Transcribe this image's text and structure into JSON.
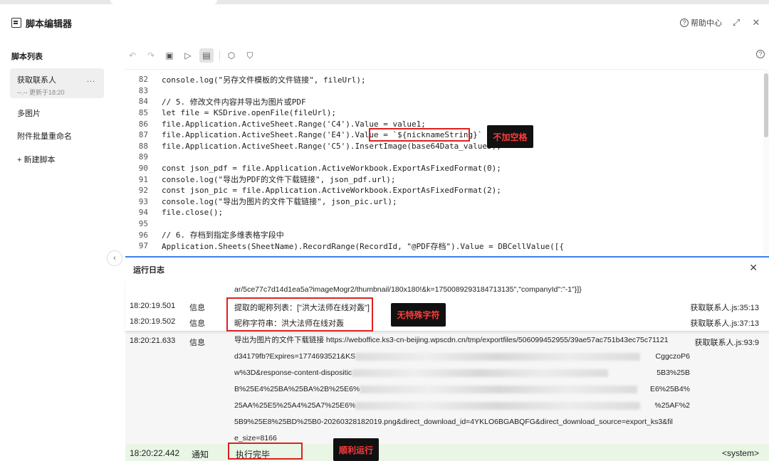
{
  "header": {
    "title": "脚本编辑器",
    "help_label": "帮助中心"
  },
  "sidebar": {
    "section_title": "脚本列表",
    "items": [
      {
        "label": "获取联系人",
        "sub": "--.-- 更新于18:20",
        "more": "..."
      },
      {
        "label": "多图片"
      },
      {
        "label": "附件批量重命名"
      },
      {
        "label": "+ 新建脚本"
      }
    ]
  },
  "code_lines": [
    {
      "ln": "82",
      "code": "console.log(\"另存文件模板的文件链接\", fileUrl);"
    },
    {
      "ln": "83",
      "code": ""
    },
    {
      "ln": "84",
      "code": "// 5. 修改文件内容并导出为图片或PDF"
    },
    {
      "ln": "85",
      "code": "let file = KSDrive.openFile(fileUrl);"
    },
    {
      "ln": "86",
      "code": "file.Application.ActiveSheet.Range('C4').Value = value1;"
    },
    {
      "ln": "87",
      "code": "file.Application.ActiveSheet.Range('E4').Value = `${nicknameString}`"
    },
    {
      "ln": "88",
      "code": "file.Application.ActiveSheet.Range('C5').InsertImage(base64Data_value3);"
    },
    {
      "ln": "89",
      "code": ""
    },
    {
      "ln": "90",
      "code": "const json_pdf = file.Application.ActiveWorkbook.ExportAsFixedFormat(0);"
    },
    {
      "ln": "91",
      "code": "console.log(\"导出为PDF的文件下载链接\", json_pdf.url);"
    },
    {
      "ln": "92",
      "code": "const json_pic = file.Application.ActiveWorkbook.ExportAsFixedFormat(2);"
    },
    {
      "ln": "93",
      "code": "console.log(\"导出为图片的文件下载链接\", json_pic.url);"
    },
    {
      "ln": "94",
      "code": "file.close();"
    },
    {
      "ln": "95",
      "code": ""
    },
    {
      "ln": "96",
      "code": "// 6. 存档到指定多维表格字段中"
    },
    {
      "ln": "97",
      "code": "Application.Sheets(SheetName).RecordRange(RecordId, \"@PDF存档\").Value = DBCellValue([{"
    }
  ],
  "log_panel": {
    "title": "运行日志",
    "close_label": "✕",
    "continued": "ar/5ce77c7d14d1ea5a?imageMogr2/thumbnail/180x180!&k=1750089293184713135\",\"companyId\":\"-1\"}]}",
    "rows": [
      {
        "time": "18:20:19.501",
        "level": "信息",
        "message": "提取的昵称列表：[\"洪大法师在线对轰\"]",
        "source": "获取联系人.js:35:13"
      },
      {
        "time": "18:20:19.502",
        "level": "信息",
        "message": "昵称字符串：洪大法师在线对轰",
        "source": "获取联系人.js:37:13"
      },
      {
        "time": "18:20:21.633",
        "level": "信息",
        "source": "获取联系人.js:93:9",
        "msg_line1": "导出为图片的文件下载链接 https://weboffice.ks3-cn-beijing.wpscdn.cn/tmp/exportfiles/506099452955/39ae57ac751b43ec75c71121",
        "msg_line2a": "d34179fb?Expires=1774693521&KS",
        "msg_line2b": "CggczoP6",
        "msg_line3a": "w%3D&response-content-dispositic",
        "msg_line3b": "5B3%25B",
        "msg_line4a": "B%25E4%25BA%25BA%2B%25E6%",
        "msg_line4b": "E6%25B4%",
        "msg_line5a": "25AA%25E5%25A4%25A7%25E6%",
        "msg_line5b": "%25AF%2",
        "msg_line6": "5B9%25E8%25BD%25B0-20260328182019.png&direct_download_id=4YKLO6BGABQFG&direct_download_source=export_ks3&fil",
        "msg_line7": "e_size=8166"
      },
      {
        "time": "18:20:22.442",
        "level": "通知",
        "message": "执行完毕",
        "source": "<system>"
      }
    ]
  },
  "annotations": {
    "no_space": "不加空格",
    "no_special_char": "无特殊字符",
    "run_ok": "顺利运行"
  },
  "colors": {
    "accent": "#3d7ef0",
    "annotation_red": "#e02020",
    "success_bg": "#e9f6e6"
  }
}
